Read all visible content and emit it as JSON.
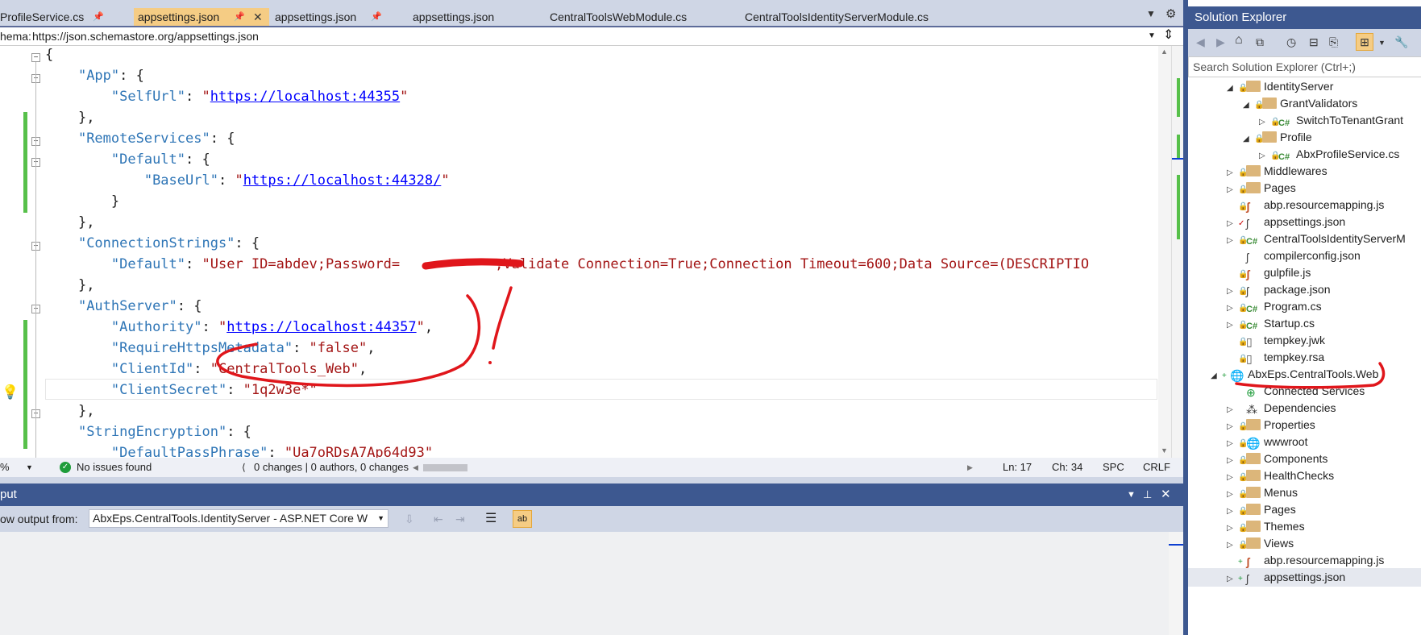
{
  "tabs": [
    {
      "label": "ProfileService.cs",
      "pinned": true,
      "active": false
    },
    {
      "label": "appsettings.json",
      "pinned": true,
      "active": true
    },
    {
      "label": "appsettings.json",
      "pinned": true,
      "active": false
    },
    {
      "label": "appsettings.json",
      "pinned": false,
      "active": false
    },
    {
      "label": "CentralToolsWebModule.cs",
      "pinned": false,
      "active": false
    },
    {
      "label": "CentralToolsIdentityServerModule.cs",
      "pinned": false,
      "active": false
    }
  ],
  "schema": {
    "label": "hema:",
    "url": "https://json.schemastore.org/appsettings.json"
  },
  "editor": {
    "lines": {
      "l1": "{",
      "l2_key": "\"App\"",
      "l2_rest": ": {",
      "l3_key": "\"SelfUrl\"",
      "l3_colon": ": ",
      "l3_q1": "\"",
      "l3_url": "https://localhost:44355",
      "l3_q2": "\"",
      "l4": "},",
      "l5_key": "\"RemoteServices\"",
      "l5_rest": ": {",
      "l6_key": "\"Default\"",
      "l6_rest": ": {",
      "l7_key": "\"BaseUrl\"",
      "l7_colon": ": ",
      "l7_q1": "\"",
      "l7_url": "https://localhost:44328/",
      "l7_q2": "\"",
      "l8": "}",
      "l9": "},",
      "l10_key": "\"ConnectionStrings\"",
      "l10_rest": ": {",
      "l11_key": "\"Default\"",
      "l11_colon": ": ",
      "l11_val1": "\"User ID=abdev;Password=",
      "l11_val2": ";Validate Connection=True;Connection Timeout=600;Data Source=(DESCRIPTIO",
      "l12": "},",
      "l13_key": "\"AuthServer\"",
      "l13_rest": ": {",
      "l14_key": "\"Authority\"",
      "l14_colon": ": ",
      "l14_q1": "\"",
      "l14_url": "https://localhost:44357",
      "l14_q2": "\"",
      "l14_end": ",",
      "l15_key": "\"RequireHttpsMetadata\"",
      "l15_colon": ": ",
      "l15_val": "\"false\"",
      "l15_end": ",",
      "l16_key": "\"ClientId\"",
      "l16_colon": ": ",
      "l16_val": "\"CentralTools_Web\"",
      "l16_end": ",",
      "l17_key": "\"ClientSecret\"",
      "l17_colon": ": ",
      "l17_val": "\"1q2w3e*\"",
      "l18": "},",
      "l19_key": "\"StringEncryption\"",
      "l19_rest": ": {",
      "l20_key": "\"DefaultPassPhrase\"",
      "l20_colon": ": ",
      "l20_val": "\"Ua7oRDsA7Ap64d93\""
    }
  },
  "editor_status": {
    "zoom": "%",
    "issues": "No issues found",
    "changes": "0 changes | 0 authors, 0 changes",
    "ln": "Ln: 17",
    "ch": "Ch: 34",
    "spc": "SPC",
    "crlf": "CRLF"
  },
  "output": {
    "title": "put",
    "show_label": "ow output from:",
    "source": "AbxEps.CentralTools.IdentityServer - ASP.NET Core W"
  },
  "solution_explorer": {
    "title": "Solution Explorer",
    "search_placeholder": "Search Solution Explorer (Ctrl+;)",
    "items": [
      {
        "label": "IdentityServer",
        "type": "folder"
      },
      {
        "label": "GrantValidators",
        "type": "folder"
      },
      {
        "label": "SwitchToTenantGrant",
        "type": "cs"
      },
      {
        "label": "Profile",
        "type": "folder"
      },
      {
        "label": "AbxProfileService.cs",
        "type": "cs"
      },
      {
        "label": "Middlewares",
        "type": "folder"
      },
      {
        "label": "Pages",
        "type": "folder"
      },
      {
        "label": "abp.resourcemapping.js",
        "type": "js"
      },
      {
        "label": "appsettings.json",
        "type": "json"
      },
      {
        "label": "CentralToolsIdentityServerM",
        "type": "cs"
      },
      {
        "label": "compilerconfig.json",
        "type": "json"
      },
      {
        "label": "gulpfile.js",
        "type": "js"
      },
      {
        "label": "package.json",
        "type": "json"
      },
      {
        "label": "Program.cs",
        "type": "cs"
      },
      {
        "label": "Startup.cs",
        "type": "cs"
      },
      {
        "label": "tempkey.jwk",
        "type": "file"
      },
      {
        "label": "tempkey.rsa",
        "type": "file"
      },
      {
        "label": "AbxEps.CentralTools.Web",
        "type": "project"
      },
      {
        "label": "Connected Services",
        "type": "service"
      },
      {
        "label": "Dependencies",
        "type": "deps"
      },
      {
        "label": "Properties",
        "type": "props"
      },
      {
        "label": "wwwroot",
        "type": "globe"
      },
      {
        "label": "Components",
        "type": "folder"
      },
      {
        "label": "HealthChecks",
        "type": "folder"
      },
      {
        "label": "Menus",
        "type": "folder"
      },
      {
        "label": "Pages",
        "type": "folder"
      },
      {
        "label": "Themes",
        "type": "folder"
      },
      {
        "label": "Views",
        "type": "folder"
      },
      {
        "label": "abp.resourcemapping.js",
        "type": "js"
      },
      {
        "label": "appsettings.json",
        "type": "json"
      }
    ]
  },
  "colors": {
    "annotation": "#e0161b",
    "accent": "#3d5890",
    "active_tab": "#f5cc84"
  }
}
